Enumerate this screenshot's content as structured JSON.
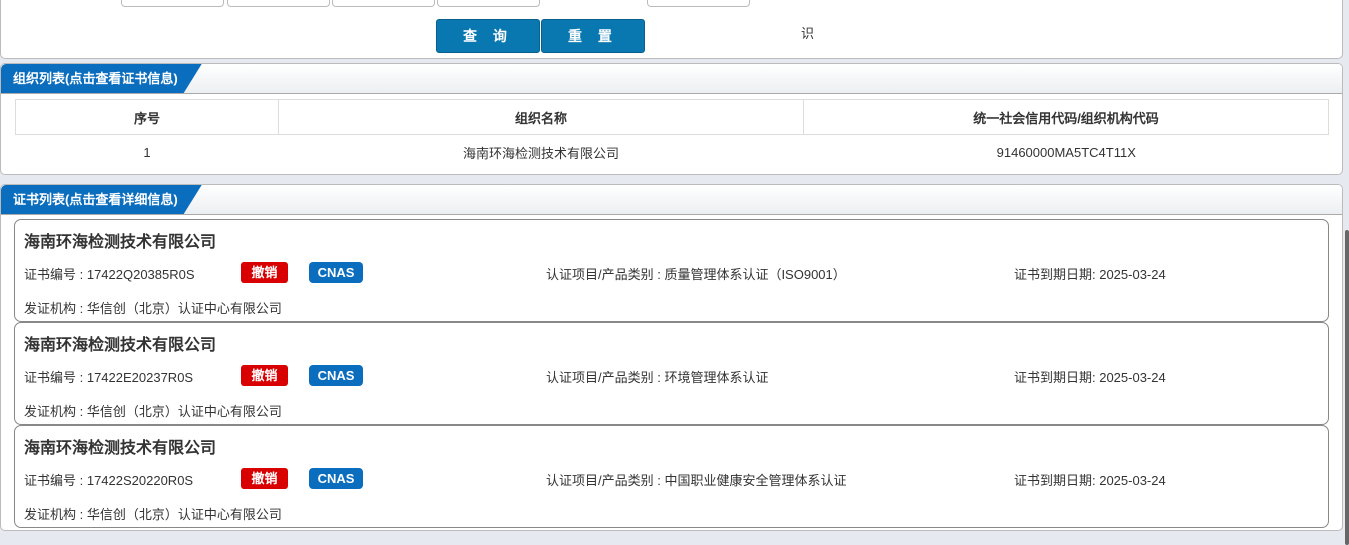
{
  "search": {
    "query_label": "查 询",
    "reset_label": "重 置",
    "partial_text": "识"
  },
  "org_list": {
    "title": "组织列表(点击查看证书信息)",
    "columns": [
      "序号",
      "组织名称",
      "统一社会信用代码/组织机构代码"
    ],
    "rows": [
      {
        "index": "1",
        "name": "海南环海检测技术有限公司",
        "code": "91460000MA5TC4T11X"
      }
    ]
  },
  "cert_list": {
    "title": "证书列表(点击查看详细信息)",
    "cards": [
      {
        "company": "海南环海检测技术有限公司",
        "cert_no": "证书编号 : 17422Q20385R0S",
        "status": "撤销",
        "accreditation": "CNAS",
        "category": "认证项目/产品类别 : 质量管理体系认证（ISO9001）",
        "expiry": "证书到期日期: 2025-03-24",
        "issuer": "发证机构 : 华信创（北京）认证中心有限公司"
      },
      {
        "company": "海南环海检测技术有限公司",
        "cert_no": "证书编号 : 17422E20237R0S",
        "status": "撤销",
        "accreditation": "CNAS",
        "category": "认证项目/产品类别 : 环境管理体系认证",
        "expiry": "证书到期日期: 2025-03-24",
        "issuer": "发证机构 : 华信创（北京）认证中心有限公司"
      },
      {
        "company": "海南环海检测技术有限公司",
        "cert_no": "证书编号 : 17422S20220R0S",
        "status": "撤销",
        "accreditation": "CNAS",
        "category": "认证项目/产品类别 : 中国职业健康安全管理体系认证",
        "expiry": "证书到期日期: 2025-03-24",
        "issuer": "发证机构 : 华信创（北京）认证中心有限公司"
      }
    ]
  },
  "colors": {
    "primary": "#0b6dbd",
    "button": "#0a78b0",
    "revoked": "#d80000"
  }
}
